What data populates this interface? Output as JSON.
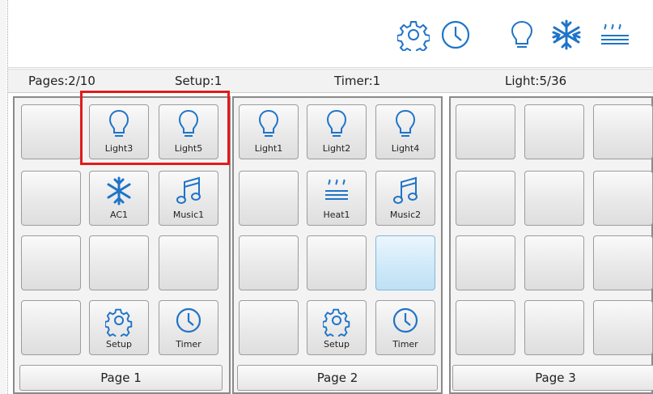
{
  "status": {
    "pages": "Pages:2/10",
    "setup": "Setup:1",
    "timer": "Timer:1",
    "light": "Light:5/36"
  },
  "toolbar": {
    "icons": [
      "gear-icon",
      "clock-icon",
      "bulb-icon",
      "snowflake-icon",
      "heat-icon"
    ]
  },
  "colors": {
    "icon_blue": "#1f74c8",
    "highlight_red": "#e21b1b",
    "active_tile": "#cde8f8"
  },
  "pages": [
    {
      "label": "Page 1",
      "tiles": [
        {
          "label": "",
          "icon": ""
        },
        {
          "label": "Light3",
          "icon": "bulb-icon"
        },
        {
          "label": "Light5",
          "icon": "bulb-icon"
        },
        {
          "label": "",
          "icon": ""
        },
        {
          "label": "AC1",
          "icon": "snowflake-icon"
        },
        {
          "label": "Music1",
          "icon": "music-icon"
        },
        {
          "label": "",
          "icon": ""
        },
        {
          "label": "",
          "icon": ""
        },
        {
          "label": "",
          "icon": ""
        },
        {
          "label": "",
          "icon": ""
        },
        {
          "label": "Setup",
          "icon": "gear-icon"
        },
        {
          "label": "Timer",
          "icon": "clock-icon"
        }
      ]
    },
    {
      "label": "Page 2",
      "tiles": [
        {
          "label": "Light1",
          "icon": "bulb-icon"
        },
        {
          "label": "Light2",
          "icon": "bulb-icon"
        },
        {
          "label": "Light4",
          "icon": "bulb-icon"
        },
        {
          "label": "",
          "icon": ""
        },
        {
          "label": "Heat1",
          "icon": "heat-icon"
        },
        {
          "label": "Music2",
          "icon": "music-icon"
        },
        {
          "label": "",
          "icon": ""
        },
        {
          "label": "",
          "icon": ""
        },
        {
          "label": "",
          "icon": "",
          "active": true
        },
        {
          "label": "",
          "icon": ""
        },
        {
          "label": "Setup",
          "icon": "gear-icon"
        },
        {
          "label": "Timer",
          "icon": "clock-icon"
        }
      ]
    },
    {
      "label": "Page 3",
      "tiles": [
        {
          "label": "",
          "icon": ""
        },
        {
          "label": "",
          "icon": ""
        },
        {
          "label": "",
          "icon": ""
        },
        {
          "label": "",
          "icon": ""
        },
        {
          "label": "",
          "icon": ""
        },
        {
          "label": "",
          "icon": ""
        },
        {
          "label": "",
          "icon": ""
        },
        {
          "label": "",
          "icon": ""
        },
        {
          "label": "",
          "icon": ""
        },
        {
          "label": "",
          "icon": ""
        },
        {
          "label": "",
          "icon": ""
        },
        {
          "label": "",
          "icon": ""
        }
      ]
    }
  ]
}
